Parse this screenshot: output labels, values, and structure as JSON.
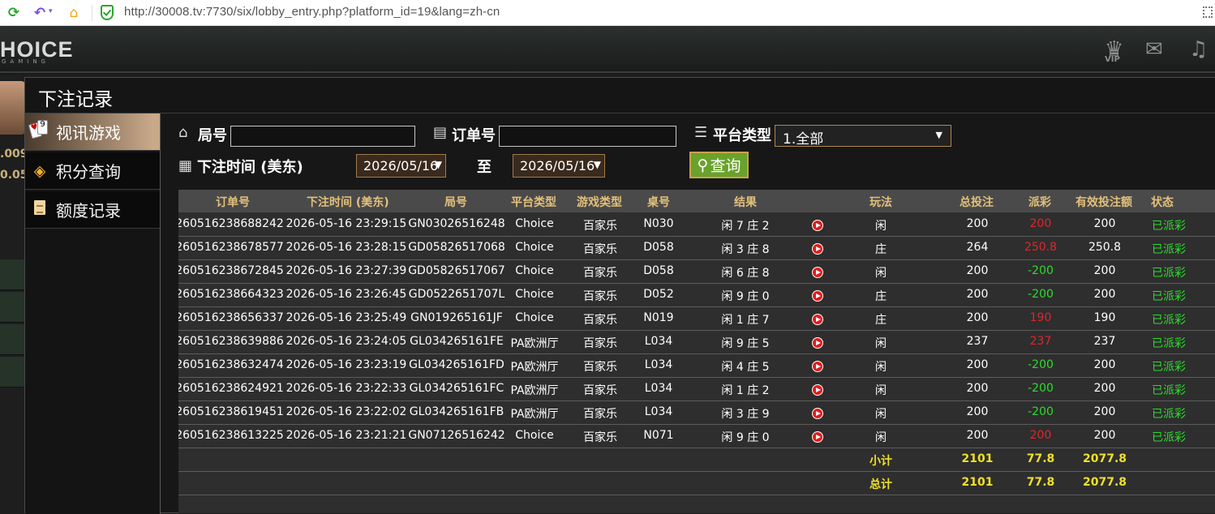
{
  "browser": {
    "url": "http://30008.tv:7730/six/lobby_entry.php?platform_id=19&lang=zh-cn",
    "icons": [
      "refresh-icon",
      "undo-icon",
      "home-icon",
      "shield-icon",
      "qr-icon"
    ]
  },
  "header": {
    "logo": "HOICE",
    "logo_sub": "GAMING",
    "vip_label": "VIP"
  },
  "background": {
    "num1": ".009",
    "num2": "0.05"
  },
  "modal": {
    "title": "下注记录"
  },
  "sidebar": {
    "items": [
      {
        "label": "视讯游戏",
        "icon": "cards-icon",
        "active": true
      },
      {
        "label": "积分查询",
        "icon": "diamond-icon",
        "active": false
      },
      {
        "label": "额度记录",
        "icon": "document-icon",
        "active": false
      }
    ]
  },
  "filters": {
    "round_label": "局号",
    "round_value": "",
    "order_label": "订单号",
    "order_value": "",
    "platform_label": "平台类型",
    "platform_value": "1.全部",
    "time_label": "下注时间 (美东)",
    "date_from": "2026/05/16",
    "to_label": "至",
    "date_to": "2026/05/16",
    "query_label": "查询"
  },
  "table": {
    "headers": [
      "订单号",
      "下注时间 (美东)",
      "局号",
      "平台类型",
      "游戏类型",
      "桌号",
      "结果",
      "玩法",
      "总投注",
      "派彩",
      "有效投注额",
      "状态"
    ],
    "rows": [
      {
        "order": "260516238688242",
        "time": "2026-05-16 23:29:15",
        "round": "GN03026516248",
        "platform": "Choice",
        "game": "百家乐",
        "table": "N030",
        "result": "闲 7 庄 2",
        "bet_type": "闲",
        "total": "200",
        "payout": "200",
        "payout_color": "red",
        "valid": "200",
        "status": "已派彩"
      },
      {
        "order": "260516238678577",
        "time": "2026-05-16 23:28:15",
        "round": "GD05826517068",
        "platform": "Choice",
        "game": "百家乐",
        "table": "D058",
        "result": "闲 3 庄 8",
        "bet_type": "庄",
        "total": "264",
        "payout": "250.8",
        "payout_color": "red",
        "valid": "250.8",
        "status": "已派彩"
      },
      {
        "order": "260516238672845",
        "time": "2026-05-16 23:27:39",
        "round": "GD05826517067",
        "platform": "Choice",
        "game": "百家乐",
        "table": "D058",
        "result": "闲 6 庄 8",
        "bet_type": "闲",
        "total": "200",
        "payout": "-200",
        "payout_color": "green",
        "valid": "200",
        "status": "已派彩"
      },
      {
        "order": "260516238664323",
        "time": "2026-05-16 23:26:45",
        "round": "GD0522651707L",
        "platform": "Choice",
        "game": "百家乐",
        "table": "D052",
        "result": "闲 9 庄 0",
        "bet_type": "庄",
        "total": "200",
        "payout": "-200",
        "payout_color": "green",
        "valid": "200",
        "status": "已派彩"
      },
      {
        "order": "260516238656337",
        "time": "2026-05-16 23:25:49",
        "round": "GN019265161JF",
        "platform": "Choice",
        "game": "百家乐",
        "table": "N019",
        "result": "闲 1 庄 7",
        "bet_type": "庄",
        "total": "200",
        "payout": "190",
        "payout_color": "red",
        "valid": "190",
        "status": "已派彩"
      },
      {
        "order": "260516238639886",
        "time": "2026-05-16 23:24:05",
        "round": "GL034265161FE",
        "platform": "PA欧洲厅",
        "game": "百家乐",
        "table": "L034",
        "result": "闲 9 庄 5",
        "bet_type": "闲",
        "total": "237",
        "payout": "237",
        "payout_color": "red",
        "valid": "237",
        "status": "已派彩"
      },
      {
        "order": "260516238632474",
        "time": "2026-05-16 23:23:19",
        "round": "GL034265161FD",
        "platform": "PA欧洲厅",
        "game": "百家乐",
        "table": "L034",
        "result": "闲 4 庄 5",
        "bet_type": "闲",
        "total": "200",
        "payout": "-200",
        "payout_color": "green",
        "valid": "200",
        "status": "已派彩"
      },
      {
        "order": "260516238624921",
        "time": "2026-05-16 23:22:33",
        "round": "GL034265161FC",
        "platform": "PA欧洲厅",
        "game": "百家乐",
        "table": "L034",
        "result": "闲 1 庄 2",
        "bet_type": "闲",
        "total": "200",
        "payout": "-200",
        "payout_color": "green",
        "valid": "200",
        "status": "已派彩"
      },
      {
        "order": "260516238619451",
        "time": "2026-05-16 23:22:02",
        "round": "GL034265161FB",
        "platform": "PA欧洲厅",
        "game": "百家乐",
        "table": "L034",
        "result": "闲 3 庄 9",
        "bet_type": "闲",
        "total": "200",
        "payout": "-200",
        "payout_color": "green",
        "valid": "200",
        "status": "已派彩"
      },
      {
        "order": "260516238613225",
        "time": "2026-05-16 23:21:21",
        "round": "GN07126516242",
        "platform": "Choice",
        "game": "百家乐",
        "table": "N071",
        "result": "闲 9 庄 0",
        "bet_type": "闲",
        "total": "200",
        "payout": "200",
        "payout_color": "red",
        "valid": "200",
        "status": "已派彩"
      }
    ],
    "subtotal": {
      "label": "小计",
      "total": "2101",
      "payout": "77.8",
      "valid": "2077.8"
    },
    "grandtotal": {
      "label": "总计",
      "total": "2101",
      "payout": "77.8",
      "valid": "2077.8"
    }
  },
  "colors": {
    "header_text": "#e2c07a",
    "payout_win": "#e0262a",
    "payout_lose": "#2cdc2c",
    "status": "#2cdc2c",
    "sum_text": "#f0e02a",
    "query_btn": "#6aa22c"
  }
}
